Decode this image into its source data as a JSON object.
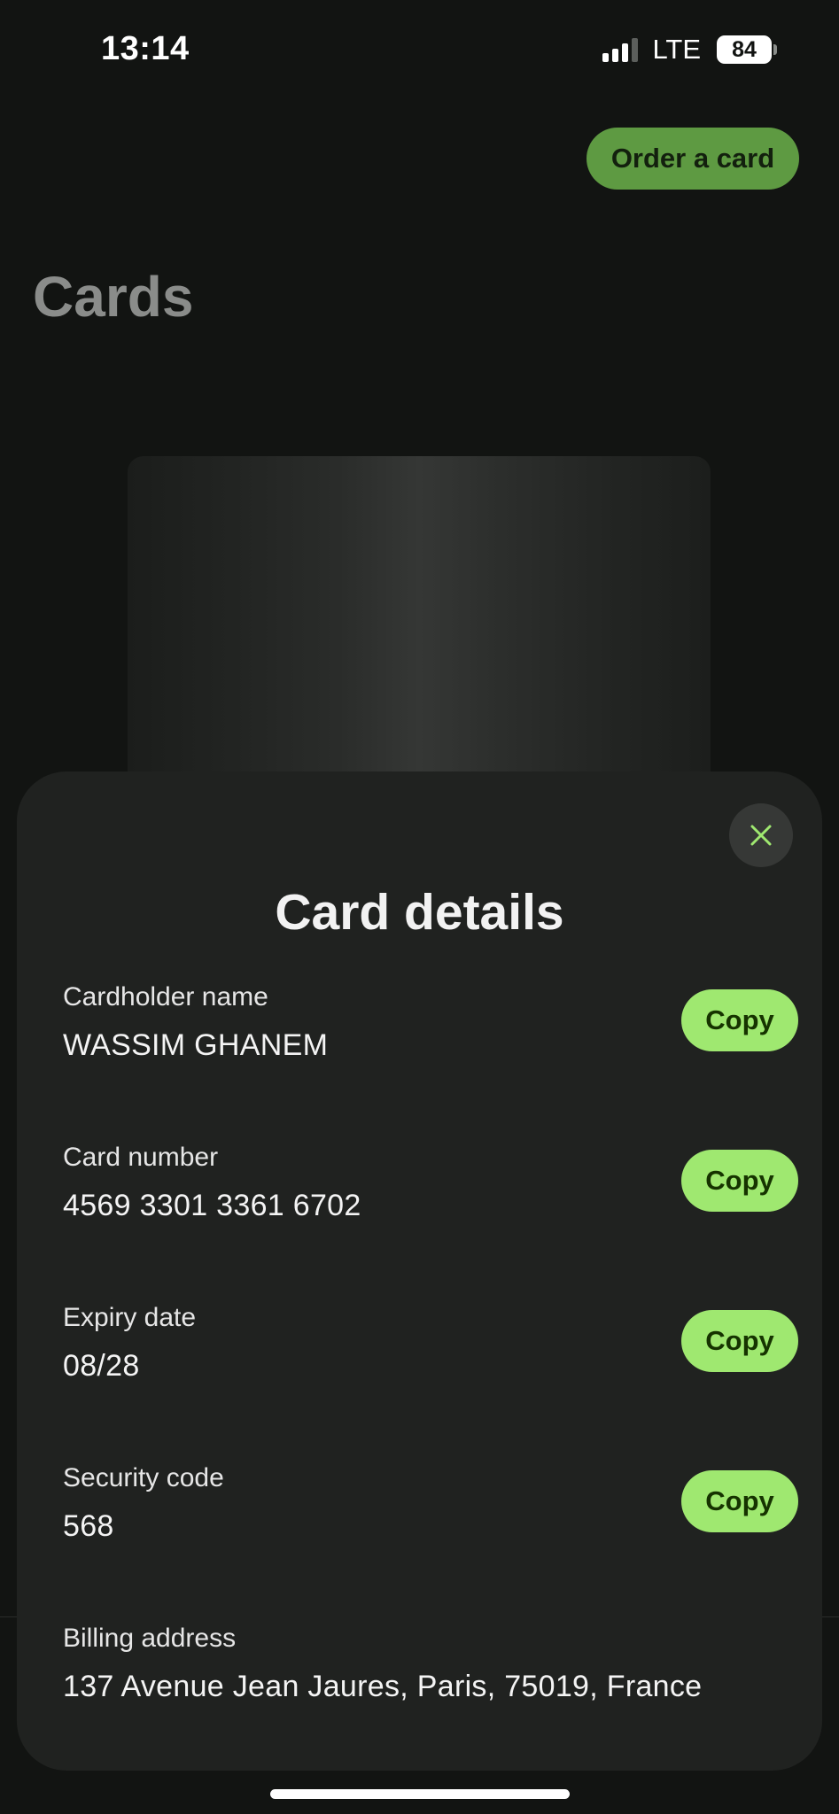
{
  "status_bar": {
    "time": "13:14",
    "network": "LTE",
    "battery": "84"
  },
  "header": {
    "order_button_label": "Order a card",
    "title": "Cards"
  },
  "sheet": {
    "title": "Card details",
    "close_icon": "close-icon",
    "accent_color": "#9fe870",
    "fields": [
      {
        "label": "Cardholder name",
        "value": "WASSIM GHANEM",
        "action": "Copy"
      },
      {
        "label": "Card number",
        "value": "4569 3301 3361 6702",
        "action": "Copy"
      },
      {
        "label": "Expiry date",
        "value": "08/28",
        "action": "Copy"
      },
      {
        "label": "Security code",
        "value": "568",
        "action": "Copy"
      },
      {
        "label": "Billing address",
        "value": "137 Avenue Jean Jaures, Paris, 75019, France"
      }
    ]
  }
}
